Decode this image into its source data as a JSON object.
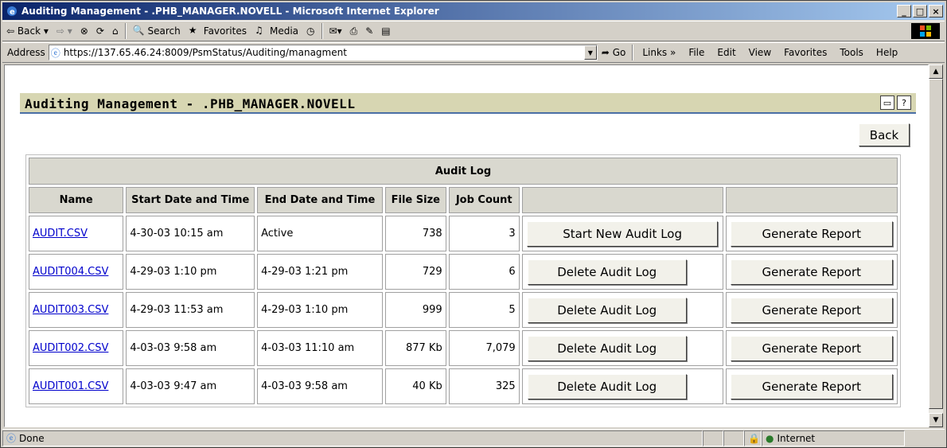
{
  "window": {
    "title": "Auditing Management - .PHB_MANAGER.NOVELL - Microsoft Internet Explorer",
    "minimize": "_",
    "maximize": "□",
    "close": "×"
  },
  "toolbar": {
    "back": "Back",
    "search": "Search",
    "favorites": "Favorites",
    "media": "Media"
  },
  "addressbar": {
    "label": "Address",
    "url": "https://137.65.46.24:8009/PsmStatus/Auditing/managment",
    "go": "Go",
    "links": "Links",
    "menu": [
      "File",
      "Edit",
      "View",
      "Favorites",
      "Tools",
      "Help"
    ]
  },
  "page": {
    "title": "Auditing Management - .PHB_MANAGER.NOVELL",
    "back_button": "Back"
  },
  "table": {
    "caption": "Audit Log",
    "columns": [
      "Name",
      "Start Date and Time",
      "End Date and Time",
      "File Size",
      "Job Count",
      "",
      ""
    ],
    "rows": [
      {
        "name": "AUDIT.CSV",
        "start": "4-30-03 10:15 am",
        "end": "Active",
        "size": "738",
        "jobs": "3",
        "action": "Start New Audit Log",
        "report": "Generate Report"
      },
      {
        "name": "AUDIT004.CSV",
        "start": "4-29-03 1:10 pm",
        "end": "4-29-03 1:21 pm",
        "size": "729",
        "jobs": "6",
        "action": "Delete Audit Log",
        "report": "Generate Report"
      },
      {
        "name": "AUDIT003.CSV",
        "start": "4-29-03 11:53 am",
        "end": "4-29-03 1:10 pm",
        "size": "999",
        "jobs": "5",
        "action": "Delete Audit Log",
        "report": "Generate Report"
      },
      {
        "name": "AUDIT002.CSV",
        "start": "4-03-03 9:58 am",
        "end": "4-03-03 11:10 am",
        "size": "877 Kb",
        "jobs": "7,079",
        "action": "Delete Audit Log",
        "report": "Generate Report"
      },
      {
        "name": "AUDIT001.CSV",
        "start": "4-03-03 9:47 am",
        "end": "4-03-03 9:58 am",
        "size": "40 Kb",
        "jobs": "325",
        "action": "Delete Audit Log",
        "report": "Generate Report"
      }
    ]
  },
  "status": {
    "text": "Done",
    "zone": "Internet"
  }
}
